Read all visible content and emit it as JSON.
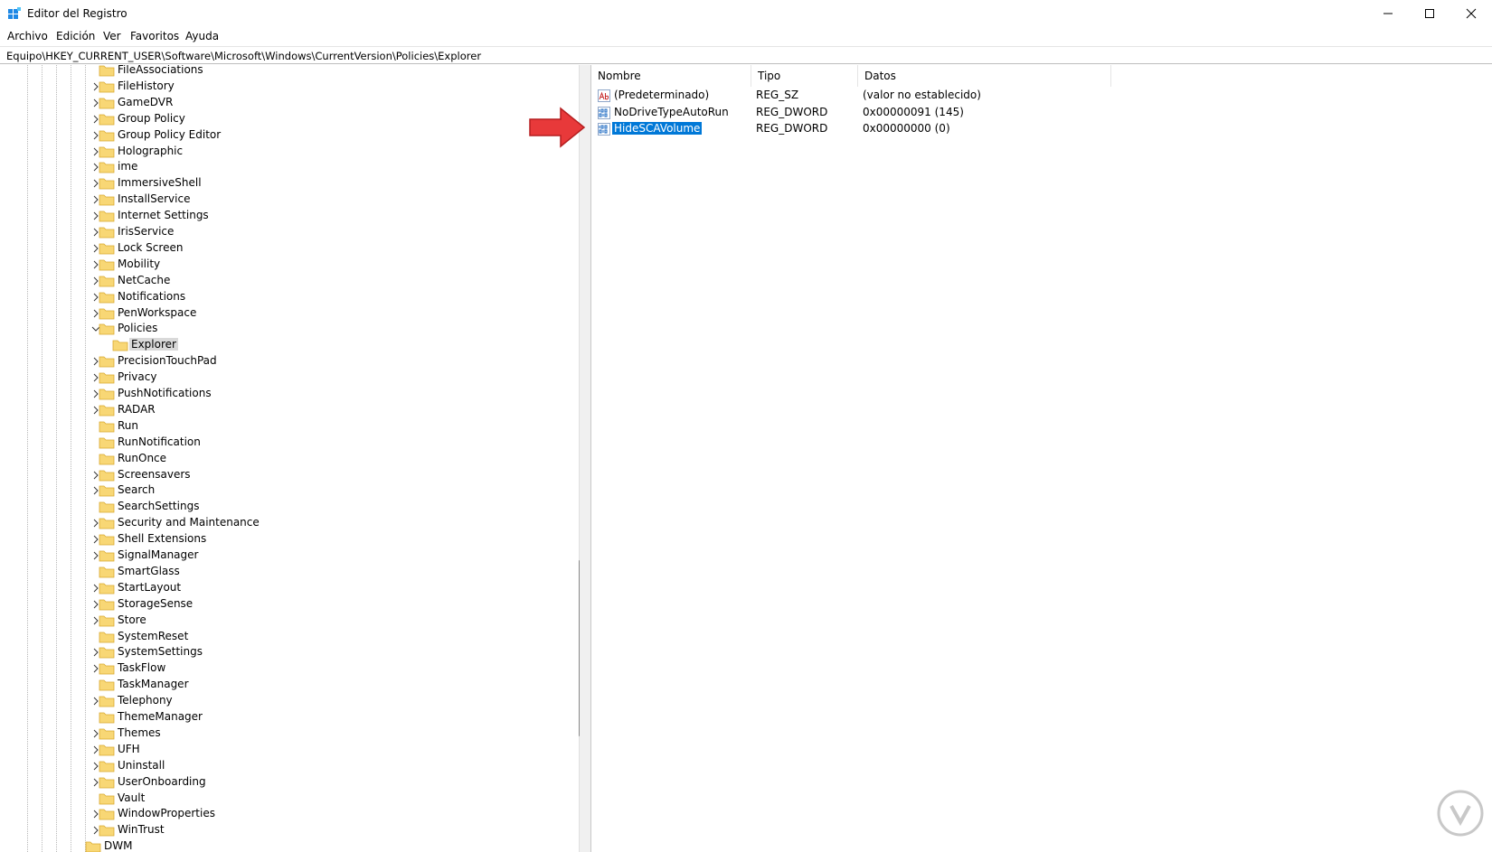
{
  "window": {
    "title": "Editor del Registro",
    "icon": "regedit-icon",
    "controls": [
      "minimize-icon",
      "maximize-icon",
      "close-icon"
    ]
  },
  "menu": [
    "Archivo",
    "Edición",
    "Ver",
    "Favoritos",
    "Ayuda"
  ],
  "address": "Equipo\\HKEY_CURRENT_USER\\Software\\Microsoft\\Windows\\CurrentVersion\\Policies\\Explorer",
  "tree": {
    "nodes": [
      {
        "label": "FileAssociations",
        "expander": "none",
        "indent": 1,
        "selected": false
      },
      {
        "label": "FileHistory",
        "expander": "collapsed",
        "indent": 1,
        "selected": false
      },
      {
        "label": "GameDVR",
        "expander": "collapsed",
        "indent": 1,
        "selected": false
      },
      {
        "label": "Group Policy",
        "expander": "collapsed",
        "indent": 1,
        "selected": false
      },
      {
        "label": "Group Policy Editor",
        "expander": "collapsed",
        "indent": 1,
        "selected": false
      },
      {
        "label": "Holographic",
        "expander": "collapsed",
        "indent": 1,
        "selected": false
      },
      {
        "label": "ime",
        "expander": "collapsed",
        "indent": 1,
        "selected": false
      },
      {
        "label": "ImmersiveShell",
        "expander": "collapsed",
        "indent": 1,
        "selected": false
      },
      {
        "label": "InstallService",
        "expander": "collapsed",
        "indent": 1,
        "selected": false
      },
      {
        "label": "Internet Settings",
        "expander": "collapsed",
        "indent": 1,
        "selected": false
      },
      {
        "label": "IrisService",
        "expander": "collapsed",
        "indent": 1,
        "selected": false
      },
      {
        "label": "Lock Screen",
        "expander": "collapsed",
        "indent": 1,
        "selected": false
      },
      {
        "label": "Mobility",
        "expander": "collapsed",
        "indent": 1,
        "selected": false
      },
      {
        "label": "NetCache",
        "expander": "collapsed",
        "indent": 1,
        "selected": false
      },
      {
        "label": "Notifications",
        "expander": "collapsed",
        "indent": 1,
        "selected": false
      },
      {
        "label": "PenWorkspace",
        "expander": "collapsed",
        "indent": 1,
        "selected": false
      },
      {
        "label": "Policies",
        "expander": "expanded",
        "indent": 1,
        "selected": false
      },
      {
        "label": "Explorer",
        "expander": "none",
        "indent": 2,
        "selected": true
      },
      {
        "label": "PrecisionTouchPad",
        "expander": "collapsed",
        "indent": 1,
        "selected": false
      },
      {
        "label": "Privacy",
        "expander": "collapsed",
        "indent": 1,
        "selected": false
      },
      {
        "label": "PushNotifications",
        "expander": "collapsed",
        "indent": 1,
        "selected": false
      },
      {
        "label": "RADAR",
        "expander": "collapsed",
        "indent": 1,
        "selected": false
      },
      {
        "label": "Run",
        "expander": "none",
        "indent": 1,
        "selected": false
      },
      {
        "label": "RunNotification",
        "expander": "none",
        "indent": 1,
        "selected": false
      },
      {
        "label": "RunOnce",
        "expander": "none",
        "indent": 1,
        "selected": false
      },
      {
        "label": "Screensavers",
        "expander": "collapsed",
        "indent": 1,
        "selected": false
      },
      {
        "label": "Search",
        "expander": "collapsed",
        "indent": 1,
        "selected": false
      },
      {
        "label": "SearchSettings",
        "expander": "none",
        "indent": 1,
        "selected": false
      },
      {
        "label": "Security and Maintenance",
        "expander": "collapsed",
        "indent": 1,
        "selected": false
      },
      {
        "label": "Shell Extensions",
        "expander": "collapsed",
        "indent": 1,
        "selected": false
      },
      {
        "label": "SignalManager",
        "expander": "collapsed",
        "indent": 1,
        "selected": false
      },
      {
        "label": "SmartGlass",
        "expander": "none",
        "indent": 1,
        "selected": false
      },
      {
        "label": "StartLayout",
        "expander": "collapsed",
        "indent": 1,
        "selected": false
      },
      {
        "label": "StorageSense",
        "expander": "collapsed",
        "indent": 1,
        "selected": false
      },
      {
        "label": "Store",
        "expander": "collapsed",
        "indent": 1,
        "selected": false
      },
      {
        "label": "SystemReset",
        "expander": "none",
        "indent": 1,
        "selected": false
      },
      {
        "label": "SystemSettings",
        "expander": "collapsed",
        "indent": 1,
        "selected": false
      },
      {
        "label": "TaskFlow",
        "expander": "collapsed",
        "indent": 1,
        "selected": false
      },
      {
        "label": "TaskManager",
        "expander": "none",
        "indent": 1,
        "selected": false
      },
      {
        "label": "Telephony",
        "expander": "collapsed",
        "indent": 1,
        "selected": false
      },
      {
        "label": "ThemeManager",
        "expander": "none",
        "indent": 1,
        "selected": false
      },
      {
        "label": "Themes",
        "expander": "collapsed",
        "indent": 1,
        "selected": false
      },
      {
        "label": "UFH",
        "expander": "collapsed",
        "indent": 1,
        "selected": false
      },
      {
        "label": "Uninstall",
        "expander": "collapsed",
        "indent": 1,
        "selected": false
      },
      {
        "label": "UserOnboarding",
        "expander": "collapsed",
        "indent": 1,
        "selected": false
      },
      {
        "label": "Vault",
        "expander": "none",
        "indent": 1,
        "selected": false
      },
      {
        "label": "WindowProperties",
        "expander": "collapsed",
        "indent": 1,
        "selected": false
      },
      {
        "label": "WinTrust",
        "expander": "collapsed",
        "indent": 1,
        "selected": false
      },
      {
        "label": "DWM",
        "expander": "none",
        "indent": 0,
        "selected": false
      }
    ]
  },
  "values": {
    "columns": [
      "Nombre",
      "Tipo",
      "Datos"
    ],
    "rows": [
      {
        "name": "(Predeterminado)",
        "type": "REG_SZ",
        "data": "(valor no establecido)",
        "icon": "string-value-icon",
        "selected": false
      },
      {
        "name": "NoDriveTypeAutoRun",
        "type": "REG_DWORD",
        "data": "0x00000091 (145)",
        "icon": "binary-value-icon",
        "selected": false
      },
      {
        "name": "HideSCAVolume",
        "type": "REG_DWORD",
        "data": "0x00000000 (0)",
        "icon": "binary-value-icon",
        "selected": true
      }
    ]
  },
  "colors": {
    "selection_blue": "#0078d7",
    "tree_selection": "#d9d9d9",
    "folder_yellow": "#f8d775",
    "annotation_arrow": "#e8393a"
  }
}
